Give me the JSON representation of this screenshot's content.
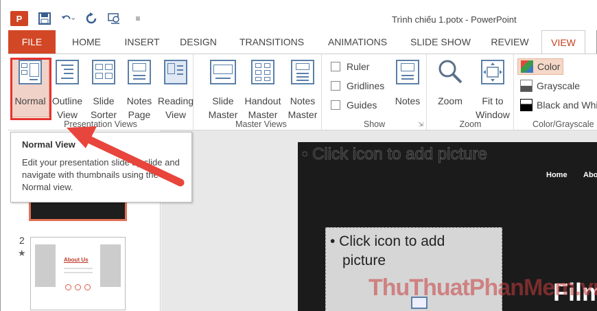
{
  "window": {
    "title": "Trình chiếu 1.potx - PowerPoint",
    "app_logo": "P"
  },
  "quick_access": {
    "icons": [
      "save-icon",
      "undo-icon",
      "redo-icon",
      "presenter-icon",
      "customize-icon"
    ]
  },
  "tabs": [
    {
      "label": "FILE"
    },
    {
      "label": "HOME"
    },
    {
      "label": "INSERT"
    },
    {
      "label": "DESIGN"
    },
    {
      "label": "TRANSITIONS"
    },
    {
      "label": "ANIMATIONS"
    },
    {
      "label": "SLIDE SHOW"
    },
    {
      "label": "REVIEW"
    },
    {
      "label": "VIEW",
      "active": true
    }
  ],
  "ribbon": {
    "presentation_views": {
      "label": "Presentation Views",
      "buttons": [
        {
          "line1": "Normal",
          "line2": "",
          "selected": true
        },
        {
          "line1": "Outline",
          "line2": "View"
        },
        {
          "line1": "Slide",
          "line2": "Sorter"
        },
        {
          "line1": "Notes",
          "line2": "Page"
        },
        {
          "line1": "Reading",
          "line2": "View"
        }
      ]
    },
    "master_views": {
      "label": "Master Views",
      "buttons": [
        {
          "line1": "Slide",
          "line2": "Master"
        },
        {
          "line1": "Handout",
          "line2": "Master"
        },
        {
          "line1": "Notes",
          "line2": "Master"
        }
      ]
    },
    "show": {
      "label": "Show",
      "checkboxes": [
        {
          "label": "Ruler",
          "checked": false
        },
        {
          "label": "Gridlines",
          "checked": false
        },
        {
          "label": "Guides",
          "checked": false
        }
      ],
      "notes_label": "Notes"
    },
    "zoom": {
      "label": "Zoom",
      "buttons": [
        {
          "line1": "Zoom",
          "line2": ""
        },
        {
          "line1": "Fit to",
          "line2": "Window"
        }
      ]
    },
    "color_grayscale": {
      "label": "Color/Grayscale",
      "options": [
        {
          "label": "Color",
          "selected": true,
          "color": "#3a78c3"
        },
        {
          "label": "Grayscale",
          "color": "#777777"
        },
        {
          "label": "Black and White",
          "color": "#000000"
        }
      ]
    }
  },
  "tooltip": {
    "title": "Normal View",
    "body": "Edit your presentation slide by slide and navigate with thumbnails using the Normal view."
  },
  "thumbnails": {
    "slide2_number": "2",
    "slide2_star": "★",
    "slide2_title": "About Us"
  },
  "slide": {
    "placeholder_top": "• Click icon to add picture",
    "nav_home": "Home",
    "nav_about": "Abo",
    "placeholder_line1": "• Click icon to add",
    "placeholder_line2": "picture",
    "big_text": "Film"
  },
  "watermark": "ThuThuatPhanMem.vn",
  "colors": {
    "file_tab": "#d24726",
    "active_tab_text": "#c43e1c",
    "highlight_box": "#e5322d",
    "arrow": "#e8453c"
  }
}
